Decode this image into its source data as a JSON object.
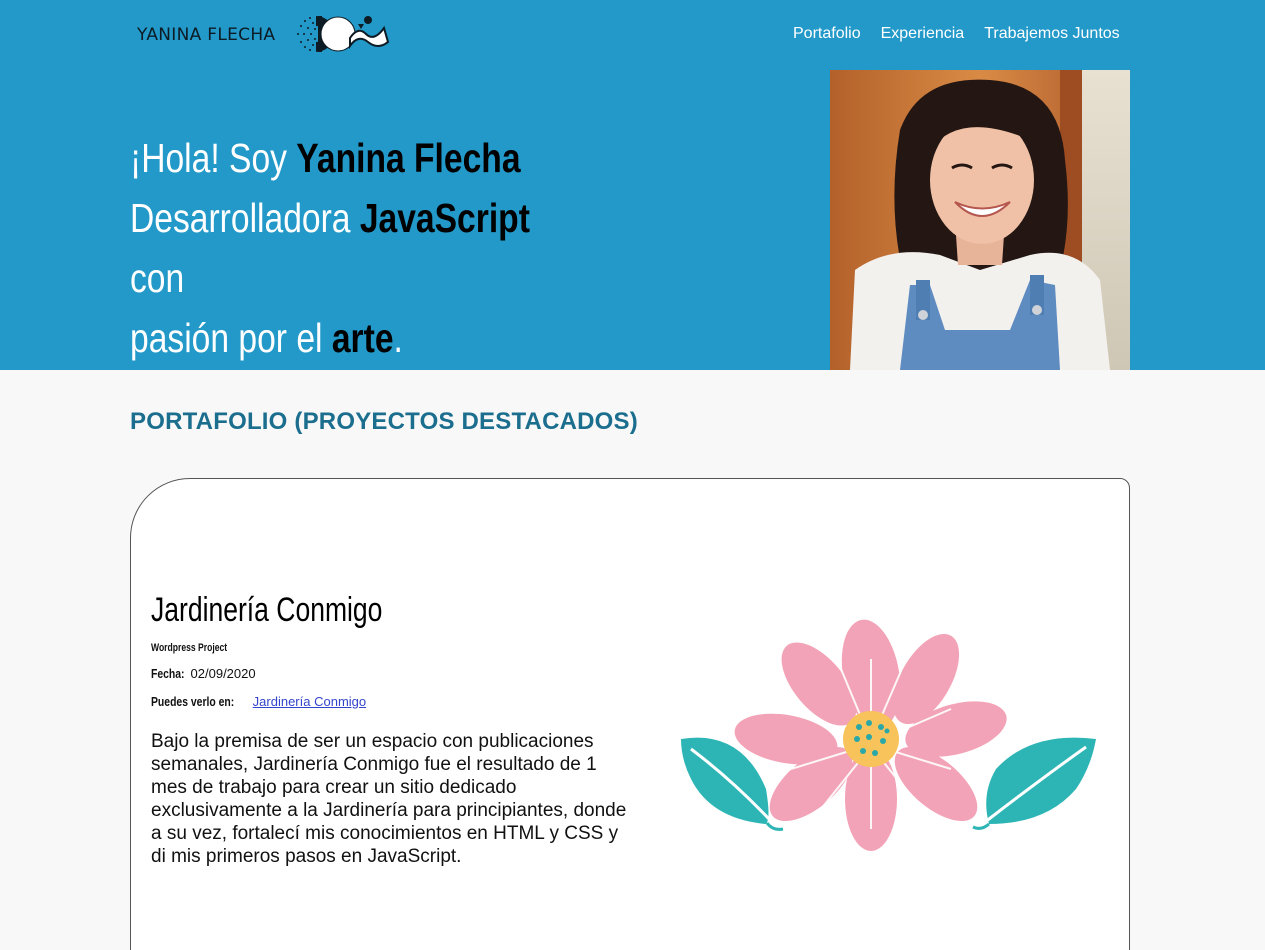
{
  "header": {
    "brand": "YANINA FLECHA",
    "nav": [
      "Portafolio",
      "Experiencia",
      "Trabajemos Juntos"
    ]
  },
  "hero": {
    "line1_a": "¡Hola! Soy ",
    "line1_b": "Yanina Flecha",
    "line2_a": "Desarrolladora ",
    "line2_b": "JavaScript",
    "line2_c": " con",
    "line3_a": "pasión por el ",
    "line3_b": "arte",
    "line3_c": "."
  },
  "portfolio": {
    "title": "PORTAFOLIO (PROYECTOS DESTACADOS)",
    "project": {
      "name": "Jardinería Conmigo",
      "type": "Wordpress Project",
      "date_label": "Fecha:",
      "date": "02/09/2020",
      "link_label": "Puedes verlo en:",
      "link_text": "Jardinería Conmigo",
      "description": "Bajo la premisa de ser un espacio con publicaciones semanales, Jardinería Conmigo fue el resultado de 1 mes de trabajo para crear un sitio dedicado exclusivamente a la Jardinería para principiantes, donde a su vez, fortalecí mis conocimientos en HTML y CSS y di mis primeros pasos en JavaScript."
    }
  },
  "colors": {
    "hero_bg": "#2299c9",
    "section_title": "#1c6e8e",
    "flower_pink": "#f3a3b7",
    "flower_center": "#f7c35a",
    "leaf_teal": "#2db5b5"
  }
}
